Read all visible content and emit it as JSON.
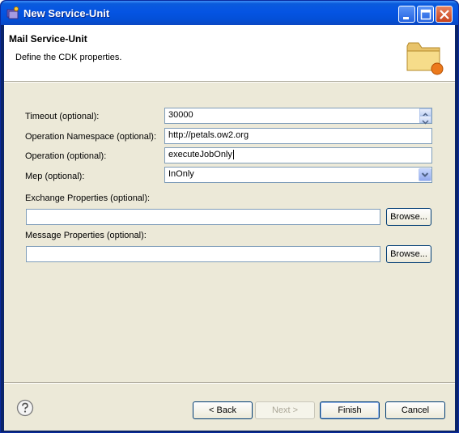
{
  "window": {
    "title": "New Service-Unit"
  },
  "banner": {
    "title": "Mail Service-Unit",
    "description": "Define the CDK properties."
  },
  "form": {
    "timeout": {
      "label": "Timeout (optional):",
      "value": "30000"
    },
    "operation_namespace": {
      "label": "Operation Namespace (optional):",
      "value": "http://petals.ow2.org"
    },
    "operation": {
      "label": "Operation (optional):",
      "value": "executeJobOnly"
    },
    "mep": {
      "label": "Mep (optional):",
      "value": "InOnly"
    },
    "exchange_properties": {
      "label": "Exchange Properties (optional):",
      "value": "",
      "browse_label": "Browse..."
    },
    "message_properties": {
      "label": "Message Properties (optional):",
      "value": "",
      "browse_label": "Browse..."
    }
  },
  "buttons": {
    "back": "< Back",
    "next": "Next >",
    "finish": "Finish",
    "cancel": "Cancel"
  },
  "colors": {
    "titlebar": "#0554e3",
    "dialog_bg": "#ECE9D8",
    "field_border": "#7f9db9",
    "close_button": "#c7421d"
  },
  "icons": {
    "app": "new-service-unit-icon",
    "banner": "folder-icon",
    "help": "help-icon"
  }
}
